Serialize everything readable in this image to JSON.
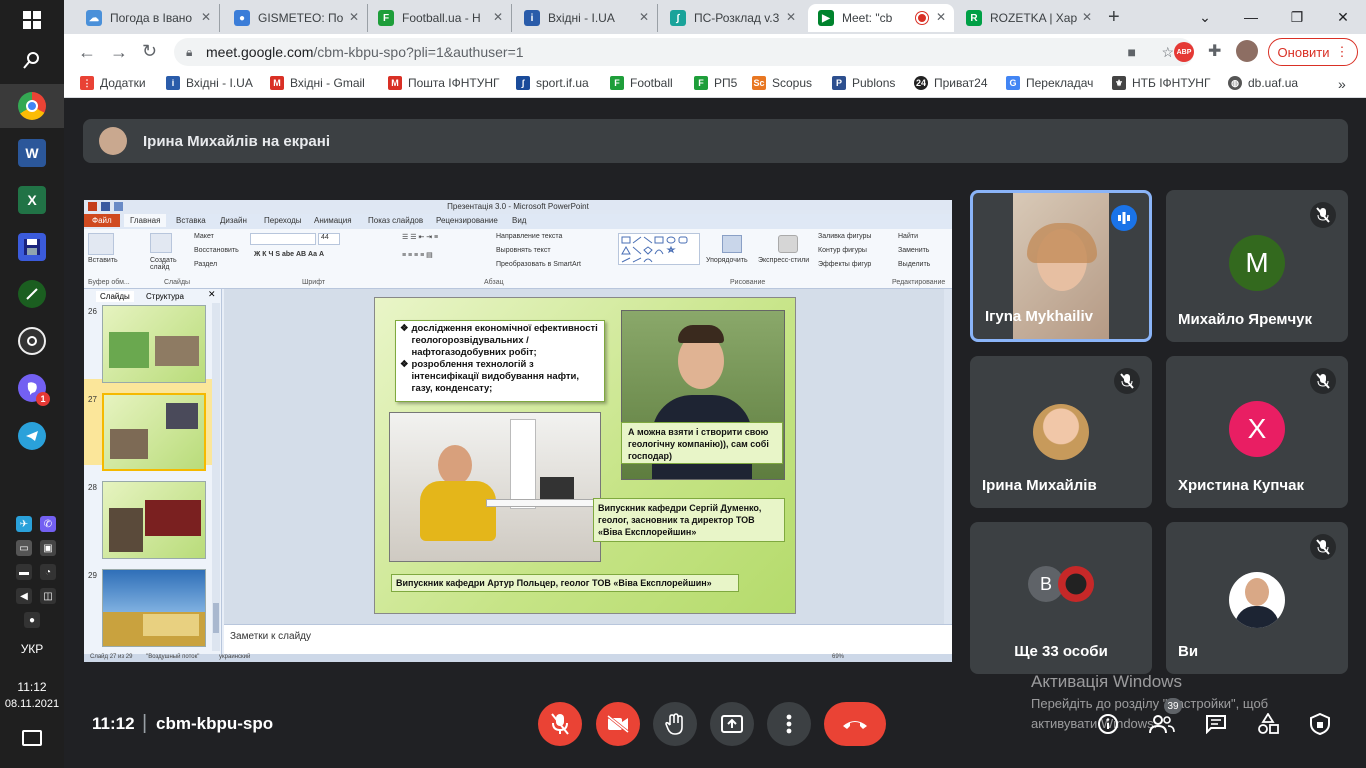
{
  "taskbar": {
    "lang": "УКР",
    "time": "11:12",
    "date": "08.11.2021",
    "viber_badge": "1"
  },
  "browser": {
    "tabs": [
      {
        "title": "Погода в Івано",
        "icon": "weather-icon",
        "color": "#4a90d9"
      },
      {
        "title": "GISMETEO: По",
        "icon": "gismeteo-icon",
        "color": "#3b7dd8"
      },
      {
        "title": "Football.ua - Н",
        "icon": "football-icon",
        "color": "#1e9e3a"
      },
      {
        "title": "Вхідні - I.UA",
        "icon": "iua-icon",
        "color": "#2a5caa"
      },
      {
        "title": "ПС-Розклад v.3",
        "icon": "schedule-icon",
        "color": "#1aa39a"
      },
      {
        "title": "Meet: \"cb",
        "icon": "meet-icon",
        "color": "#00832d"
      },
      {
        "title": "ROZETKA | Хар",
        "icon": "rozetka-icon",
        "color": "#00a046"
      }
    ],
    "url_host": "meet.google.com",
    "url_path": "/cbm-kbpu-spo?pli=1&authuser=1",
    "update_label": "Оновити",
    "abp_label": "ABP",
    "bookmarks": [
      {
        "label": "Додатки",
        "color": "#e94235"
      },
      {
        "label": "Вхідні - I.UA",
        "color": "#2a5caa"
      },
      {
        "label": "Вхідні - Gmail",
        "color": "#d93025"
      },
      {
        "label": "Пошта ІФНТУНГ",
        "color": "#d93025"
      },
      {
        "label": "sport.if.ua",
        "color": "#1a4b9a"
      },
      {
        "label": "Football",
        "color": "#1e9e3a"
      },
      {
        "label": "РП5",
        "color": "#1e9e3a"
      },
      {
        "label": "Scopus",
        "color": "#e87722"
      },
      {
        "label": "Publons",
        "color": "#2d4f8e"
      },
      {
        "label": "Приват24",
        "color": "#222"
      },
      {
        "label": "Перекладач",
        "color": "#4285f4"
      },
      {
        "label": "НТБ ІФНТУНГ",
        "color": "#444"
      },
      {
        "label": "db.uaf.ua",
        "color": "#555"
      }
    ]
  },
  "meet": {
    "presenting": "Ірина Михайлів на екрані",
    "meeting_time": "11:12",
    "meeting_code": "cbm-kbpu-spo",
    "more_count": "39",
    "participants": [
      {
        "name": "Iгуna Mykhailiv"
      },
      {
        "name": "Михайло Яремчук",
        "initial": "M",
        "color": "#33691e"
      },
      {
        "name": "Ірина Михайлів"
      },
      {
        "name": "Христина Купчак",
        "initial": "Х",
        "color": "#e91e63"
      },
      {
        "name": "Ще 33 особи",
        "initial": "B",
        "color": "#5f6368"
      },
      {
        "name": "Ви"
      }
    ]
  },
  "ppt": {
    "title": "Презентація 3.0 - Microsoft PowerPoint",
    "tabs": [
      "Файл",
      "Главная",
      "Вставка",
      "Дизайн",
      "Переходы",
      "Анимация",
      "Показ слайдов",
      "Рецензирование",
      "Вид"
    ],
    "groups": [
      "Буфер обм...",
      "Слайды",
      "Шрифт",
      "Абзац",
      "Рисование",
      "Редактирование"
    ],
    "ribbon_items": [
      "Вставить",
      "Создать слайд",
      "Макет",
      "Восстановить",
      "Раздел",
      "Направление текста",
      "Выровнять текст",
      "Преобразовать в SmartArt",
      "Упорядочить",
      "Экспресс-стили",
      "Заливка фигуры",
      "Контур фигуры",
      "Эффекты фигур",
      "Найти",
      "Заменить",
      "Выделить"
    ],
    "font_size": "44",
    "pane_tabs": [
      "Слайды",
      "Структура"
    ],
    "slide_numbers": [
      "26",
      "27",
      "28",
      "29"
    ],
    "notes": "Заметки к слайду",
    "status_left": "Слайд 27 из 29",
    "status_theme": "\"Воздушный поток\"",
    "status_lang": "украинский",
    "zoom": "69%",
    "slide": {
      "bullet1": "дослідження економічної ефективності геологорозвідувальних / нафтогазодобувних робіт;",
      "bullet2": "розроблення технологій з інтенсифікації видобування нафти, газу, конденсату;",
      "quote": "А можна взяти і створити свою геологічну компанію)), сам собі господар)",
      "caption1": "Випускник кафедри Сергій Думенко, геолог, засновник та директор ТОВ «Віва Експлорейшин»",
      "caption2": "Випускник кафедри Артур Польцер, геолог ТОВ «Віва Експлорейшин»"
    }
  },
  "watermark": {
    "title": "Активація Windows",
    "line1": "Перейдіть до розділу \"Настройки\", щоб",
    "line2": "активувати Windows."
  }
}
